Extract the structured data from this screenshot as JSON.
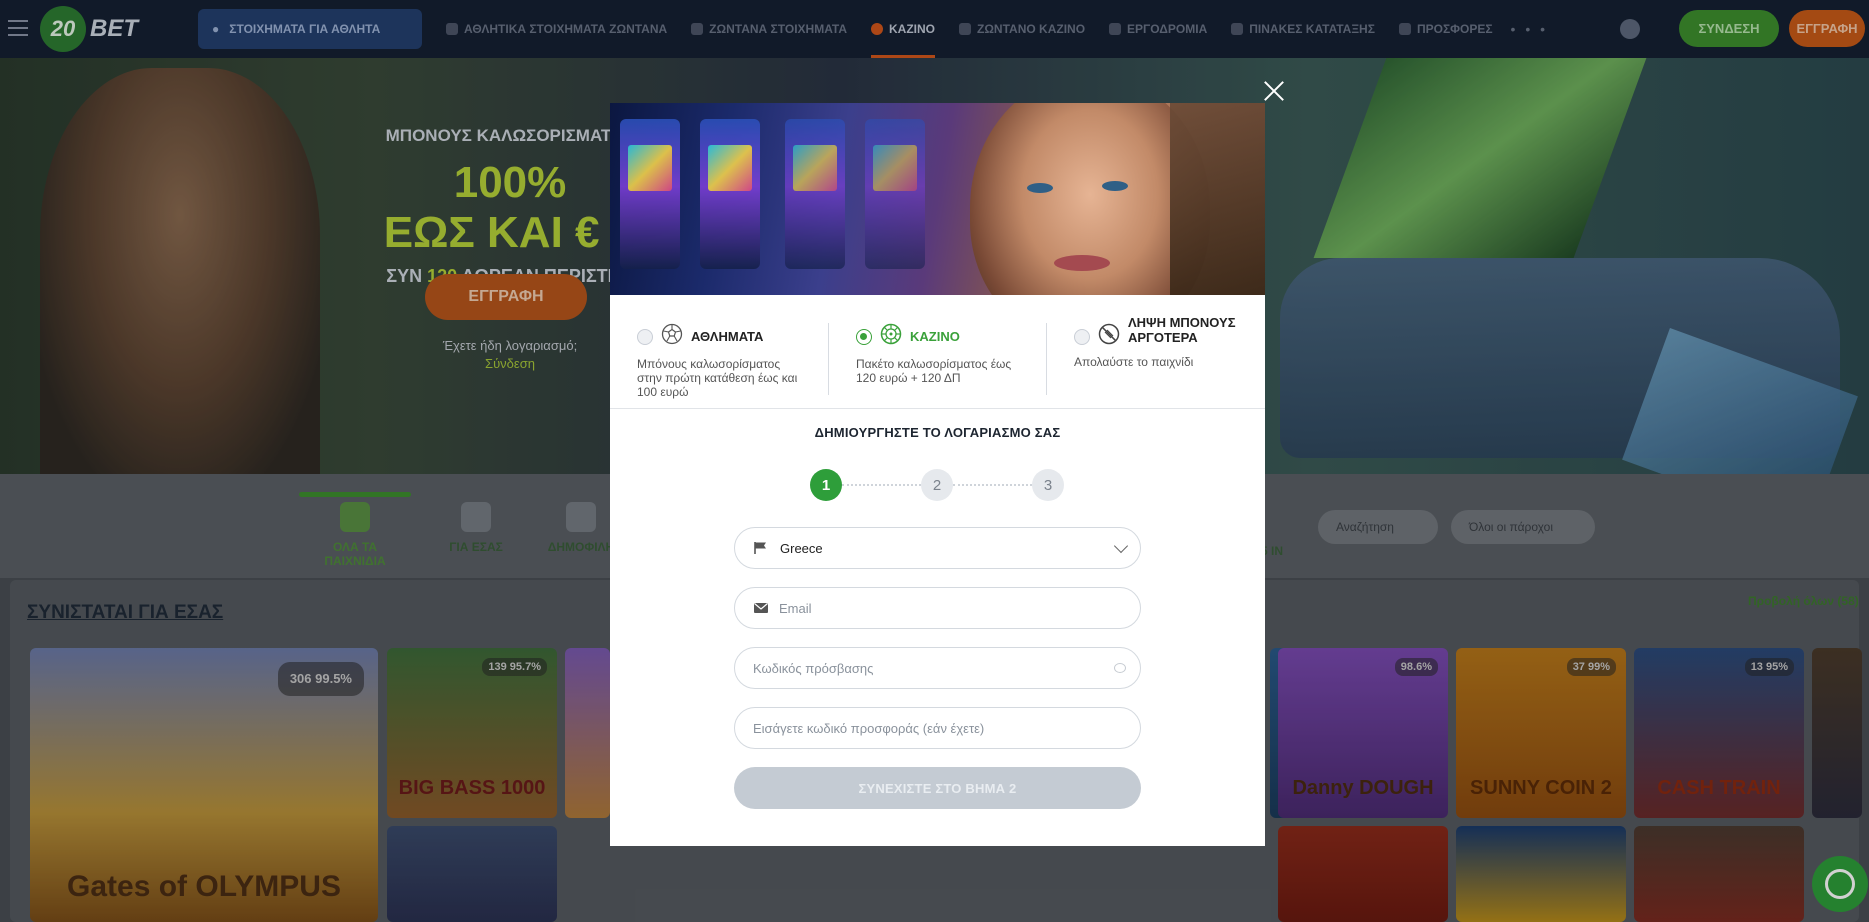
{
  "header": {
    "logo_text": "20 BET",
    "sports_live_label": "ΣΤΟΙΧΗΜΑΤΑ ΓΙΑ ΑΘΛΗΤΑ",
    "nav": [
      {
        "label": "ΑΘΛΗΤΙΚΑ ΣΤΟΙΧΗΜΑΤΑ ΖΩΝΤΑΝΑ"
      },
      {
        "label": "ΖΩΝΤΑΝΑ ΣΤΟΙΧΗΜΑΤΑ"
      },
      {
        "label": "ΚΑΖΙΝΟ"
      },
      {
        "label": "ΖΩΝΤΑΝΟ ΚΑΖΙΝΟ"
      },
      {
        "label": "ΕΡΓΟΔΡΟΜΙΑ"
      },
      {
        "label": "ΠΙΝΑΚΕΣ ΚΑΤΑΤΑΞΗΣ"
      },
      {
        "label": "ΠΡΟΣΦΟΡΕΣ"
      }
    ],
    "more_label": "• • •",
    "login_label": "ΣΥΝΔΕΣΗ",
    "register_label": "ΕΓΓΡΑΦΗ"
  },
  "hero": {
    "title": "ΜΠΟΝΟΥΣ ΚΑΛΩΣΟΡΙΣΜΑΤΟΣ",
    "big_line1": "100%",
    "big_line2": "ΕΩΣ ΚΑΙ € 1",
    "sub_prefix": "ΣΥΝ ",
    "sub_highlight": "120",
    "sub_suffix": " ΔΩΡΕΑΝ ΠΕΡΙΣΤΡΟ",
    "cta_label": "ΕΓΓΡΑΦΗ",
    "account_question": "Έχετε ήδη λογαριασμό;",
    "login_link": "Σύνδεση"
  },
  "games_bar": {
    "categories": [
      {
        "label": "ΟΛΑ ΤΑ ΠΑΙΧΝΙΔΙΑ",
        "active": true
      },
      {
        "label": "ΓΙΑ ΕΣΑΣ",
        "active": false
      },
      {
        "label": "ΔΗΜΟΦΙΛΗ",
        "active": false
      }
    ],
    "search_placeholder": "Αναζήτηση",
    "provider_placeholder": "Όλοι οι πάροχοι",
    "extra_label": "5 IN"
  },
  "recommended": {
    "title": "ΣΥΝΙΣΤΑΤΑΙ ΓΙΑ ΕΣΑΣ",
    "show_all": "Προβολή όλων (58)",
    "tiles": [
      {
        "name": "Gates of OLYMPUS",
        "badge": "306 99.5%"
      },
      {
        "name": "BIG BASS 1000",
        "badge": "139 95.7%"
      },
      {
        "name": "Danny DOUGH",
        "badge": "98.6%"
      },
      {
        "name": "SUNNY COIN 2",
        "badge": "37 99%"
      },
      {
        "name": "CASH TRAIN",
        "badge": "13 95%"
      }
    ]
  },
  "modal": {
    "close_label": "×",
    "bonus_options": [
      {
        "title": "ΑΘΛΗΜΑΤΑ",
        "desc": "Μπόνους καλωσορίσματος στην πρώτη κατάθεση έως και 100 ευρώ",
        "selected": false
      },
      {
        "title": "ΚΑΖΙΝΟ",
        "desc": "Πακέτο καλωσορίσματος έως 120 ευρώ + 120 ΔΠ",
        "selected": true
      },
      {
        "title": "ΛΗΨΗ ΜΠΟΝΟΥΣ ΑΡΓΟΤΕΡΑ",
        "desc": "Απολαύστε το παιχνίδι",
        "selected": false
      }
    ],
    "heading": "ΔΗΜΙΟΥΡΓΗΣΤΕ ΤΟ ΛΟΓΑΡΙΑΣΜΟ ΣΑΣ",
    "steps": [
      "1",
      "2",
      "3"
    ],
    "current_step": 1,
    "country_value": "Greece",
    "email_placeholder": "Email",
    "password_placeholder": "Κωδικός πρόσβασης",
    "promo_placeholder": "Εισάγετε κωδικό προσφοράς (εάν έχετε)",
    "continue_label": "ΣΥΝΕΧΙΣΤΕ ΣΤΟ ΒΗΜΑ 2"
  },
  "colors": {
    "accent_green": "#3aa13a",
    "accent_orange": "#d4571c",
    "disabled_button": "#c4cbd3",
    "header_bg": "#152033"
  },
  "icons": {
    "sports": "soccer-ball-icon",
    "casino": "roulette-wheel-icon",
    "later": "no-bonus-icon",
    "country": "flag-icon",
    "email": "envelope-icon",
    "password": "eye-icon",
    "close": "close-icon",
    "chat": "chat-icon"
  }
}
